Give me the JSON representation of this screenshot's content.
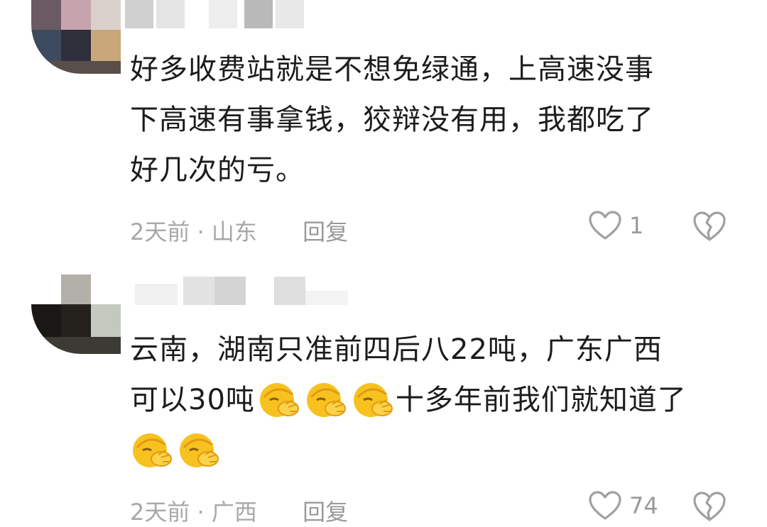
{
  "comments": [
    {
      "lines": [
        "好多收费站就是不想免绿通，上高速没事",
        "下高速有事拿钱，狡辩没有用，我都吃了",
        "好几次的亏。"
      ],
      "time": "2天前",
      "location": "山东",
      "reply_label": "回复",
      "likes": "1"
    },
    {
      "line1": "云南，湖南只准前四后八22吨，广东广西",
      "line2_pre": "可以30吨",
      "line2_post": "十多年前我们就知道了",
      "time": "2天前",
      "location": "广西",
      "reply_label": "回复",
      "likes": "74"
    }
  ],
  "separator": " · ",
  "icons": {
    "like": "heart-outline-icon",
    "dislike": "broken-heart-icon",
    "emoji": "facepalm-emoji"
  },
  "colors": {
    "meta": "#a8a8a8",
    "text": "#1c1c1c",
    "emoji": "#f7c21f"
  }
}
